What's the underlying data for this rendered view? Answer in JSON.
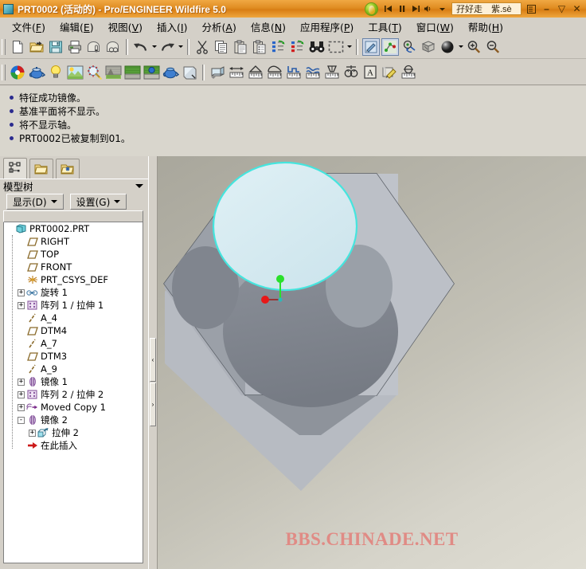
{
  "window": {
    "title": "PRT0002 (活动的) - Pro/ENGINEER Wildfire 5.0",
    "icon": "part-document-icon",
    "buttons": {
      "playlist": "playlist-icon",
      "minimize": "–",
      "restore": "▽",
      "close": "✕"
    }
  },
  "media_player": {
    "logo": "media-player-logo-icon",
    "prev": "◀◀",
    "pause": "❚❚",
    "next": "▶▶",
    "volume": "volume-icon",
    "volume_caret": "▾",
    "track_title": "孖好走　紫.sè"
  },
  "menubar": {
    "items": [
      {
        "label": "文件",
        "accel": "F"
      },
      {
        "label": "编辑",
        "accel": "E"
      },
      {
        "label": "视图",
        "accel": "V"
      },
      {
        "label": "插入",
        "accel": "I"
      },
      {
        "label": "分析",
        "accel": "A"
      },
      {
        "label": "信息",
        "accel": "N"
      },
      {
        "label": "应用程序",
        "accel": "P"
      },
      {
        "label": "工具",
        "accel": "T"
      },
      {
        "label": "窗口",
        "accel": "W"
      },
      {
        "label": "帮助",
        "accel": "H"
      }
    ]
  },
  "toolbar_top": {
    "icons": [
      "new-file-icon",
      "open-folder-icon",
      "save-icon",
      "print-icon",
      "send-mail-icon",
      "print-preview-icon",
      "undo-icon",
      "redo-icon",
      "cut-scissors-icon",
      "copy-icon",
      "paste-icon",
      "paste-special-icon",
      "regenerate-icon",
      "regenerate-modified-icon",
      "find-binoculars-icon",
      "selection-box-icon",
      "repaint-icon",
      "datum-display-icon",
      "spin-center-icon",
      "view-orientation-icon",
      "appearance-sphere-icon",
      "zoom-in-icon",
      "zoom-out-icon"
    ]
  },
  "toolbar_second": {
    "icons": [
      "shaded-colors-icon",
      "teapot-render-icon",
      "light-bulb-icon",
      "scene-icon",
      "effects-icon",
      "perspective-icon",
      "room-icon",
      "room-light-icon",
      "blue-teapot-icon",
      "material-icon",
      "model-player-icon",
      "distance-measure-icon",
      "angle-measure-icon",
      "curve-length-icon",
      "area-measure-icon",
      "curvature-icon",
      "volume-measure-icon",
      "mass-properties-icon",
      "annotation-a-icon",
      "sketch-pencil-icon",
      "diameter-measure-icon"
    ]
  },
  "messages": [
    "特征成功镜像。",
    "基准平面将不显示。",
    "将不显示轴。",
    "PRT0002已被复制到01。"
  ],
  "left_panel": {
    "tabs": [
      {
        "name": "model-tree-tab",
        "icon": "model-tree-icon",
        "active": true
      },
      {
        "name": "folder-browser-tab",
        "icon": "folder-browser-icon",
        "active": false
      },
      {
        "name": "favorites-tab",
        "icon": "favorites-folder-icon",
        "active": false
      }
    ],
    "header": "模型树",
    "header_caret": "▾",
    "buttons": [
      {
        "label": "显示",
        "accel": "D"
      },
      {
        "label": "设置",
        "accel": "G"
      }
    ],
    "tree": [
      {
        "label": "PRT0002.PRT",
        "depth": 0,
        "icon": "part-icon",
        "expander": "none"
      },
      {
        "label": "RIGHT",
        "depth": 1,
        "icon": "datum-plane-icon",
        "expander": "none"
      },
      {
        "label": "TOP",
        "depth": 1,
        "icon": "datum-plane-icon",
        "expander": "none"
      },
      {
        "label": "FRONT",
        "depth": 1,
        "icon": "datum-plane-icon",
        "expander": "none"
      },
      {
        "label": "PRT_CSYS_DEF",
        "depth": 1,
        "icon": "csys-icon",
        "expander": "none"
      },
      {
        "label": "旋转 1",
        "depth": 1,
        "icon": "revolve-icon",
        "expander": "+"
      },
      {
        "label": "阵列 1 / 拉伸 1",
        "depth": 1,
        "icon": "pattern-icon",
        "expander": "+"
      },
      {
        "label": "A_4",
        "depth": 1,
        "icon": "axis-icon",
        "expander": "none"
      },
      {
        "label": "DTM4",
        "depth": 1,
        "icon": "datum-plane-icon",
        "expander": "none"
      },
      {
        "label": "A_7",
        "depth": 1,
        "icon": "axis-icon",
        "expander": "none"
      },
      {
        "label": "DTM3",
        "depth": 1,
        "icon": "datum-plane-icon",
        "expander": "none"
      },
      {
        "label": "A_9",
        "depth": 1,
        "icon": "axis-icon",
        "expander": "none"
      },
      {
        "label": "镜像 1",
        "depth": 1,
        "icon": "mirror-icon",
        "expander": "+"
      },
      {
        "label": "阵列 2 / 拉伸 2",
        "depth": 1,
        "icon": "pattern-icon",
        "expander": "+"
      },
      {
        "label": "Moved Copy 1",
        "depth": 1,
        "icon": "moved-copy-icon",
        "expander": "+"
      },
      {
        "label": "镜像 2",
        "depth": 1,
        "icon": "mirror-icon",
        "expander": "-"
      },
      {
        "label": "拉伸 2",
        "depth": 2,
        "icon": "extrude-icon",
        "expander": "+"
      },
      {
        "label": "在此插入",
        "depth": 1,
        "icon": "insert-here-arrow-icon",
        "expander": "none"
      }
    ]
  },
  "splitter": {
    "collapse_left": "‹",
    "collapse_right": "›"
  },
  "viewport": {
    "watermark": "BBS.CHINADE.NET",
    "colors": {
      "background_top": "#a9a79c",
      "background_bottom": "#dfddd3",
      "highlight_edge": "#4fe8e0",
      "selected_face": "#d8ecf2",
      "body_light": "#b8bcc4",
      "body_mid": "#8f949c",
      "body_dark": "#6f747c",
      "axis_green": "#29e02b",
      "axis_red": "#e81818",
      "axis_cyan": "#2fb8b8"
    }
  }
}
